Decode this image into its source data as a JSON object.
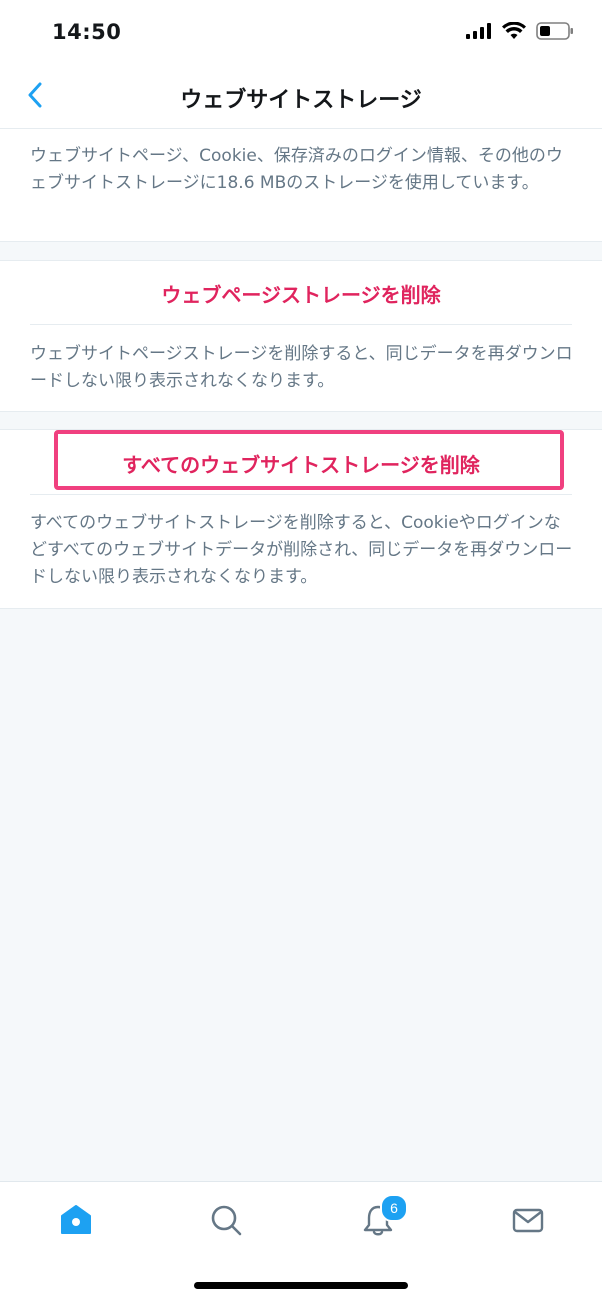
{
  "status_bar": {
    "time": "14:50"
  },
  "nav": {
    "title": "ウェブサイトストレージ"
  },
  "info": {
    "text": "ウェブサイトページ、Cookie、保存済みのログイン情報、その他のウェブサイトストレージに18.6 MBのストレージを使用しています。"
  },
  "webpage_storage": {
    "button_label": "ウェブページストレージを削除",
    "description": "ウェブサイトページストレージを削除すると、同じデータを再ダウンロードしない限り表示されなくなります。"
  },
  "all_storage": {
    "button_label": "すべてのウェブサイトストレージを削除",
    "description": "すべてのウェブサイトストレージを削除すると、Cookieやログインなどすべてのウェブサイトデータが削除され、同じデータを再ダウンロードしない限り表示されなくなります。"
  },
  "tabs": {
    "notifications_badge": "6"
  },
  "icons": {
    "back": "chevron-left-icon",
    "home": "home-icon",
    "search": "search-icon",
    "notifications": "bell-icon",
    "messages": "mail-icon"
  },
  "colors": {
    "accent": "#1da1f2",
    "destructive": "#e0245e",
    "highlight": "#f0407f"
  }
}
